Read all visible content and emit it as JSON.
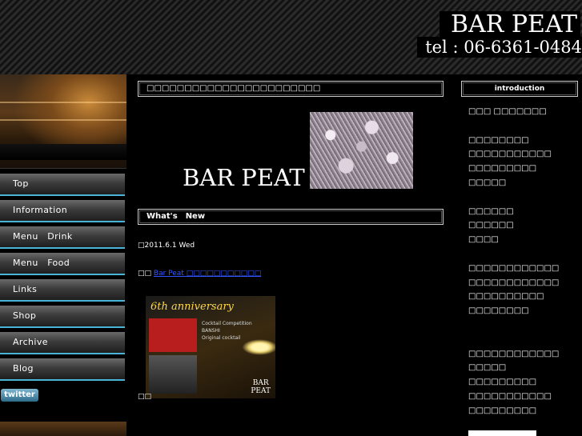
{
  "header": {
    "brand": "BAR PEAT",
    "tel": "tel : 06-6361-0484"
  },
  "left": {
    "nav": [
      {
        "label": "Top"
      },
      {
        "label": "Information"
      },
      {
        "label": "Menu　Drink"
      },
      {
        "label": "Menu　Food"
      },
      {
        "label": "Links"
      },
      {
        "label": "Shop"
      },
      {
        "label": "Archive"
      },
      {
        "label": "Blog"
      }
    ],
    "twitter_label": "twitter"
  },
  "main": {
    "title": "□□□□□□□□□□□□□□□□□□□□□□□",
    "logo_text": "BAR PEAT",
    "news_heading": "What's　New",
    "date": "□2011.6.1 Wed",
    "news_prefix": "□□",
    "news_link": "Bar Peat □□□□□□□□□□□",
    "poster_title": "6th anniversary",
    "poster_text": "Cocktail Competition\nBANSHI\nOriginal cocktail",
    "poster_brand": "BAR\nPEAT",
    "trail": "□□"
  },
  "right": {
    "heading": "introduction",
    "lines": [
      "□□□ □□□□□□□",
      "",
      "□□□□□□□□",
      "□□□□□□□□□□□",
      "□□□□□□□□□",
      "□□□□□",
      "",
      "□□□□□□",
      "□□□□□□",
      "□□□□",
      "",
      "□□□□□□□□□□□□",
      "□□□□□□□□□□□□",
      "□□□□□□□□□□",
      "□□□□□□□□",
      "",
      "",
      "□□□□□□□□□□□□",
      "□□□□□",
      "□□□□□□□□□",
      "□□□□□□□□□□□",
      "□□□□□□□□□"
    ]
  }
}
